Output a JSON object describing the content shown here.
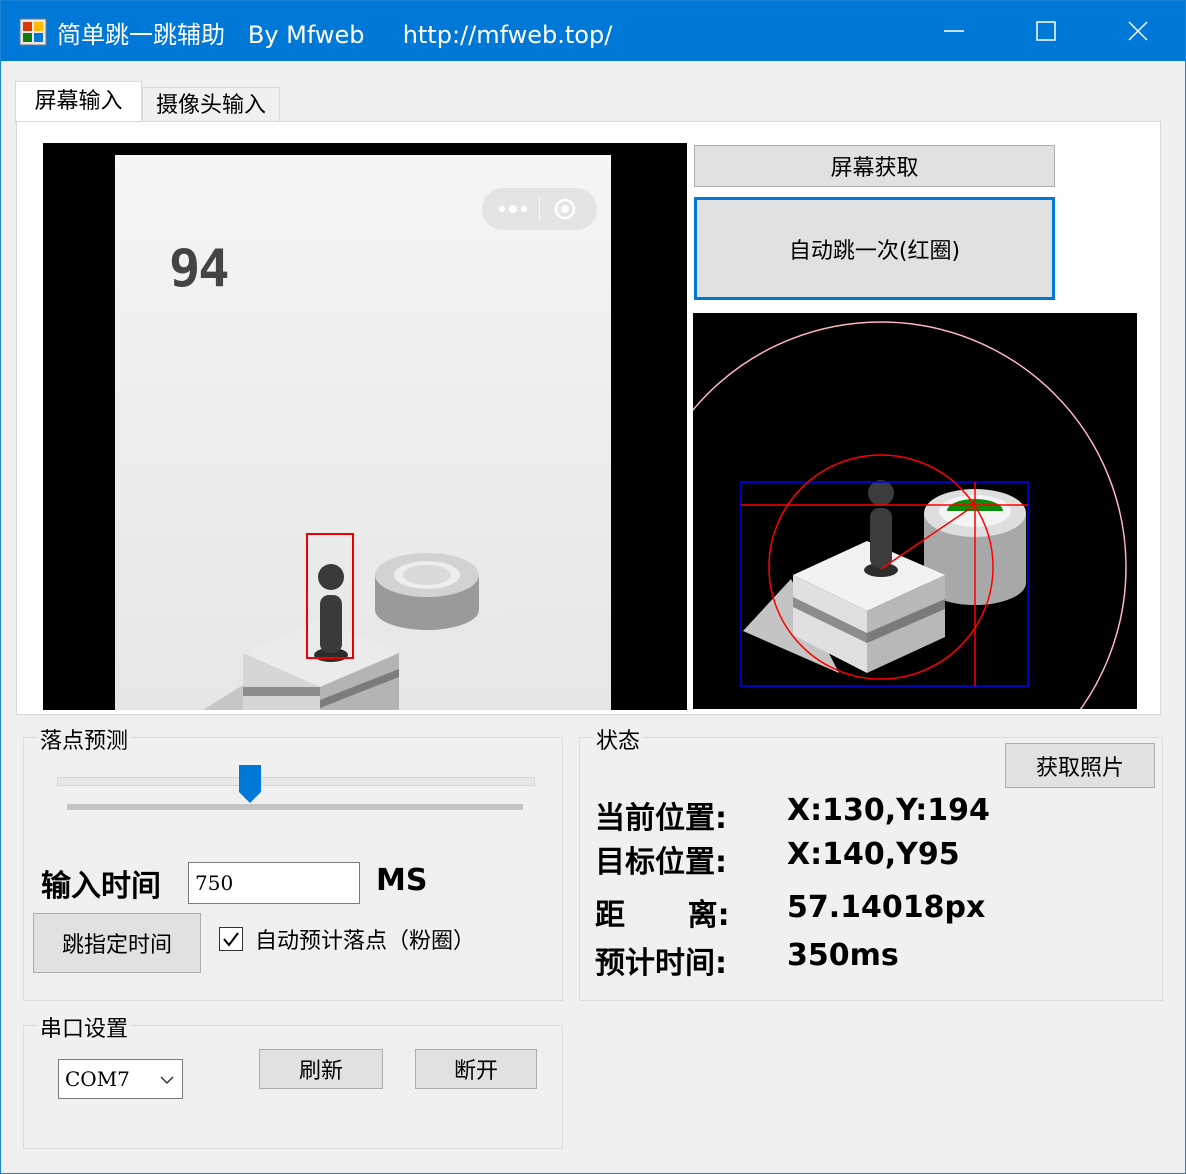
{
  "window": {
    "title": "简单跳一跳辅助   By Mfweb     http://mfweb.top/",
    "controls": [
      "minimize",
      "maximize",
      "close"
    ]
  },
  "tabs": [
    {
      "label": "屏幕输入",
      "active": true
    },
    {
      "label": "摄像头输入",
      "active": false
    }
  ],
  "screen_preview": {
    "score": "94",
    "capsule_icons": [
      "more-dots-icon",
      "target-circle-icon"
    ]
  },
  "buttons": {
    "capture_screen": "屏幕获取",
    "auto_jump_once": "自动跳一次(红圈)",
    "get_photo": "获取照片",
    "jump_specified_time": "跳指定时间",
    "refresh": "刷新",
    "disconnect": "断开"
  },
  "landing_prediction": {
    "group_label": "落点预测",
    "slider_value_percent": 40,
    "input_time_label": "输入时间",
    "input_time_value": "750",
    "unit": "MS",
    "auto_predict_label": "自动预计落点（粉圈）",
    "auto_predict_checked": true
  },
  "status": {
    "group_label": "状态",
    "current_position_label": "当前位置:",
    "current_position_value": "X:130,Y:194",
    "target_position_label": "目标位置:",
    "target_position_value": "X:140,Y95",
    "distance_label": "距      离:",
    "distance_value": "57.14018px",
    "estimated_time_label": "预计时间:",
    "estimated_time_value": "350ms"
  },
  "serial": {
    "group_label": "串口设置",
    "port_selected": "COM7"
  },
  "colors": {
    "titlebar": "#0078d7",
    "focus_border": "#0078d7",
    "detect_red": "#ff0000",
    "detect_blue": "#0000ff",
    "predict_pink": "#ffb6c1",
    "target_green": "#008000"
  }
}
